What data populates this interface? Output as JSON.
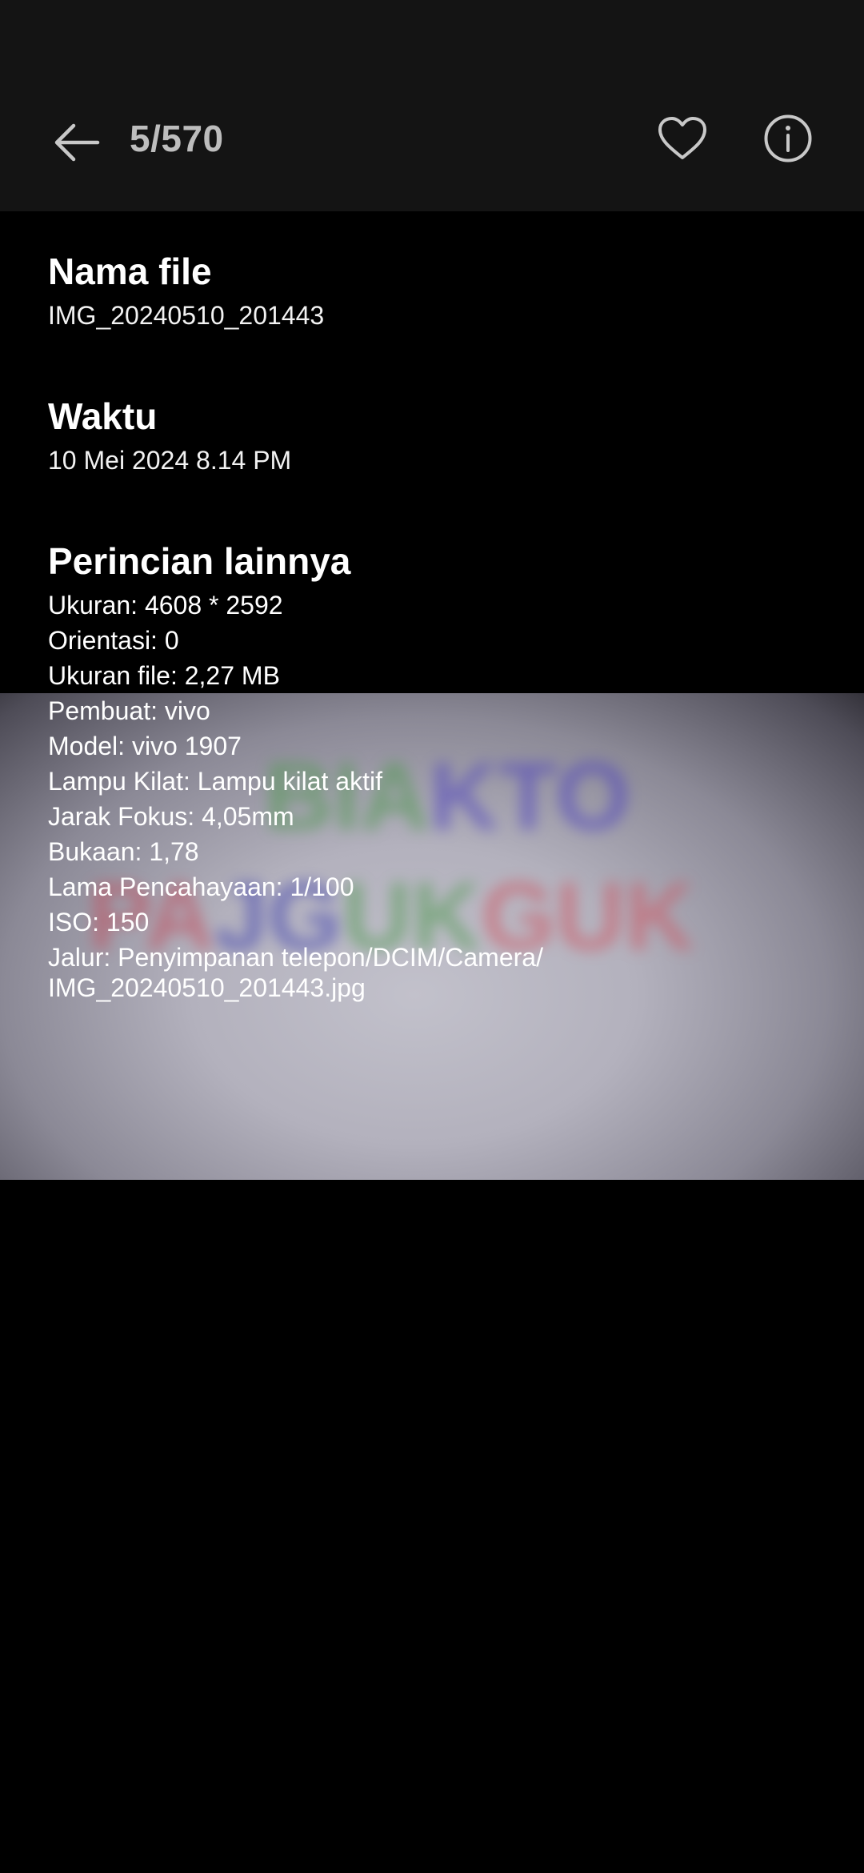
{
  "header": {
    "counter": "5/570",
    "icons": {
      "back": "arrow-left-icon",
      "favorite": "heart-outline-icon",
      "info": "info-circle-icon"
    }
  },
  "details": {
    "file_name": {
      "label": "Nama file",
      "value": "IMG_20240510_201443"
    },
    "time": {
      "label": "Waktu",
      "value": "10 Mei 2024 8.14 PM"
    },
    "other": {
      "label": "Perincian lainnya",
      "size": "Ukuran: 4608 * 2592",
      "orientation": "Orientasi: 0",
      "file_size": "Ukuran file: 2,27 MB",
      "maker": "Pembuat: vivo",
      "model": "Model: vivo 1907",
      "flash": "Lampu Kilat: Lampu kilat aktif",
      "focal_length": "Jarak Fokus: 4,05mm",
      "aperture": "Bukaan: 1,78",
      "exposure": "Lama Pencahayaan: 1/100",
      "iso": "ISO: 150",
      "path_line1": "Jalur: Penyimpanan telepon/DCIM/Camera/",
      "path_line2": "IMG_20240510_201443.jpg"
    }
  },
  "colors": {
    "topbar": "#141414",
    "background": "#000000",
    "icon": "#bdbdbd"
  }
}
